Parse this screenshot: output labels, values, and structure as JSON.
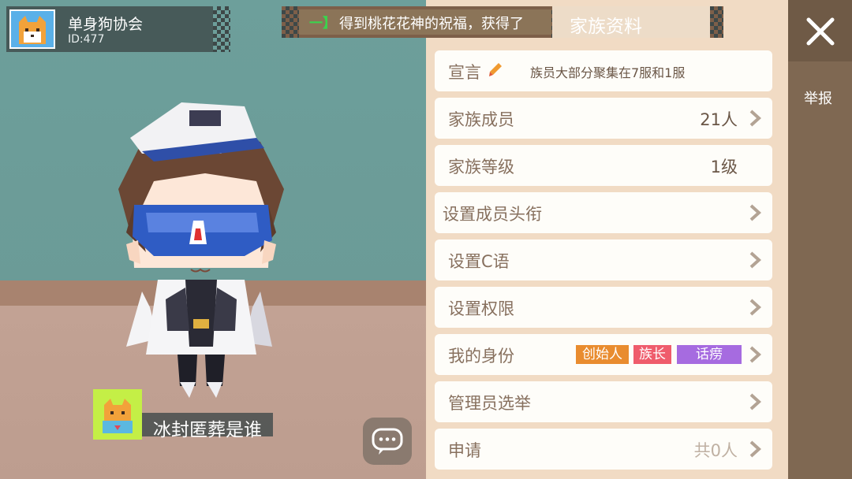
{
  "family_card": {
    "name": "单身狗协会",
    "id": "ID:477"
  },
  "notice": {
    "mark": "一】",
    "text": "得到桃花花神的祝福，获得了"
  },
  "panel": {
    "title": "家族资料",
    "declaration": {
      "label": "宣言",
      "text": "族员大部分聚集在7服和1服"
    },
    "rows": [
      {
        "label": "家族成员",
        "value": "21人"
      },
      {
        "label": "家族等级",
        "value": "1级"
      },
      {
        "label": "设置成员头衔"
      },
      {
        "label": "设置C语"
      },
      {
        "label": "设置权限"
      },
      {
        "label": "我的身份"
      },
      {
        "label": "管理员选举"
      },
      {
        "label": "申请",
        "value": "共0人"
      }
    ],
    "badges": [
      {
        "text": "创始人",
        "color": "#e98c2f"
      },
      {
        "text": "族长",
        "color": "#ef5c6c"
      },
      {
        "text": "话痨",
        "color": "#a66be0"
      }
    ]
  },
  "player": {
    "name": "冰封匿葬是谁"
  },
  "sidebar": {
    "report": "举报"
  },
  "colors": {
    "panel_bg": "#f1dbc4",
    "row_bg": "#fefdf9",
    "label_text": "#87705e",
    "sidebar": "#7f6852"
  }
}
